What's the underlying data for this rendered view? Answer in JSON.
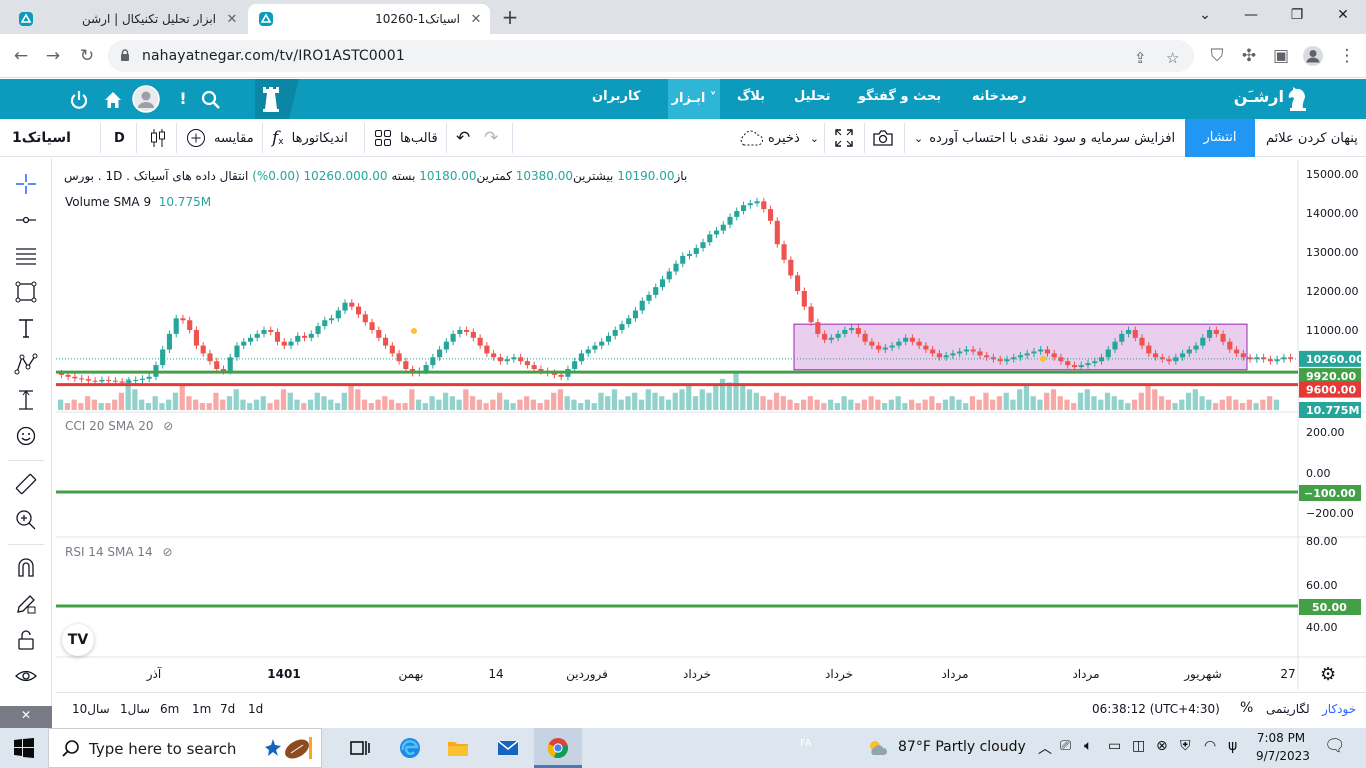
{
  "browser": {
    "tabs": [
      {
        "title": "ابزار تحلیل تکنیکال | ارشن",
        "active": false
      },
      {
        "title": "10260-اسیاتک1",
        "active": true
      }
    ],
    "url": "nahayatnegar.com/tv/IRO1ASTC0001"
  },
  "site_nav": {
    "logo": "ارشـَن",
    "items": [
      "رصدخانه",
      "بحث و گفتگو",
      "تحلیل",
      "بلاگ",
      "ابـزار",
      "کاربران"
    ]
  },
  "toolbar": {
    "symbol": "اسیاتک1",
    "interval": "D",
    "compare": "مقایسه",
    "indicators": "اندیکاتورها",
    "templates": "قالب‌ها",
    "save": "ذخیره",
    "layout_title": "افزایش سرمایه و سود نقدی با احتساب آورده",
    "publish": "انتشار",
    "hide_marks": "پنهان کردن علائم"
  },
  "chart_data": {
    "type": "candlestick",
    "legend": {
      "title": "انتقال داده های آسیاتک . 1D . بورس",
      "open_label": "باز",
      "open": "10190.00",
      "high_label": "بیشترین",
      "high": "10380.00",
      "low_label": "کمترین",
      "low": "10180.00",
      "close_label": "بسته",
      "close": "10260.000.00",
      "change": "(0.00%)",
      "volume_label": "Volume SMA 9",
      "volume_value": "10.775M"
    },
    "price_axis": [
      "15000.00",
      "14000.00",
      "13000.00",
      "12000.00",
      "11000.00"
    ],
    "price_range": [
      9480,
      15000
    ],
    "markers": [
      {
        "label": "10260.00",
        "value": 10260,
        "color": "#26a69a"
      },
      {
        "label": "9920.00",
        "value": 9920,
        "color": "#43a047"
      },
      {
        "label": "9600.00",
        "value": 9600,
        "color": "#e53935"
      },
      {
        "label": "10.775M",
        "value": null,
        "color": "#26a69a"
      }
    ],
    "rectangle": {
      "from_price": 11150,
      "to_price": 9980,
      "color": "#ce93d8"
    },
    "close_series": [
      9850,
      9800,
      9760,
      9740,
      9700,
      9680,
      9720,
      9700,
      9680,
      9650,
      9700,
      9720,
      9750,
      9800,
      10100,
      10500,
      10900,
      11300,
      11250,
      11000,
      10600,
      10400,
      10200,
      10000,
      9950,
      10300,
      10600,
      10700,
      10800,
      10900,
      11000,
      10950,
      10700,
      10600,
      10700,
      10850,
      10800,
      10900,
      11100,
      11250,
      11300,
      11500,
      11700,
      11600,
      11400,
      11200,
      11000,
      10800,
      10600,
      10400,
      10200,
      10000,
      9900,
      9950,
      10100,
      10300,
      10500,
      10700,
      10900,
      11000,
      10950,
      10800,
      10600,
      10400,
      10300,
      10200,
      10250,
      10300,
      10200,
      10100,
      10000,
      9950,
      9900,
      9850,
      9800,
      10000,
      10200,
      10400,
      10500,
      10600,
      10700,
      10850,
      11000,
      11150,
      11300,
      11500,
      11750,
      11900,
      12100,
      12300,
      12500,
      12700,
      12900,
      12950,
      13100,
      13250,
      13450,
      13550,
      13700,
      13900,
      14050,
      14200,
      14250,
      14300,
      14100,
      13800,
      13200,
      12800,
      12400,
      12000,
      11600,
      11200,
      10900,
      10750,
      10800,
      10900,
      11000,
      11050,
      10900,
      10700,
      10600,
      10500,
      10550,
      10600,
      10700,
      10800,
      10700,
      10600,
      10500,
      10400,
      10300,
      10350,
      10400,
      10450,
      10500,
      10450,
      10350,
      10300,
      10250,
      10200,
      10250,
      10300,
      10350,
      10400,
      10450,
      10500,
      10400,
      10300,
      10200,
      10100,
      10050,
      10100,
      10150,
      10200,
      10300,
      10500,
      10700,
      10900,
      11000,
      10800,
      10600,
      10400,
      10300,
      10250,
      10200,
      10300,
      10400,
      10500,
      10600,
      10800,
      11000,
      10900,
      10700,
      10500,
      10400,
      10300,
      10250,
      10300,
      10250,
      10200,
      10250,
      10300,
      10260
    ],
    "volumes": [
      3,
      2,
      3,
      2,
      4,
      3,
      2,
      2,
      3,
      5,
      9,
      6,
      3,
      2,
      4,
      2,
      3,
      5,
      7,
      4,
      3,
      2,
      2,
      5,
      3,
      4,
      6,
      3,
      2,
      3,
      4,
      2,
      3,
      6,
      5,
      3,
      2,
      3,
      5,
      4,
      3,
      2,
      5,
      7,
      6,
      3,
      2,
      3,
      4,
      3,
      2,
      2,
      6,
      3,
      2,
      4,
      3,
      5,
      4,
      3,
      6,
      4,
      3,
      2,
      3,
      5,
      3,
      2,
      3,
      4,
      3,
      2,
      3,
      5,
      6,
      4,
      3,
      2,
      3,
      2,
      5,
      4,
      6,
      3,
      4,
      5,
      3,
      6,
      5,
      4,
      3,
      5,
      6,
      7,
      4,
      6,
      5,
      7,
      9,
      8,
      11,
      7,
      6,
      5,
      4,
      3,
      5,
      4,
      3,
      2,
      3,
      4,
      3,
      2,
      3,
      2,
      4,
      3,
      2,
      3,
      4,
      3,
      2,
      3,
      4,
      2,
      3,
      2,
      3,
      4,
      2,
      3,
      4,
      3,
      2,
      4,
      3,
      5,
      3,
      4,
      5,
      3,
      6,
      7,
      4,
      3,
      5,
      6,
      4,
      3,
      2,
      5,
      6,
      4,
      3,
      5,
      4,
      3,
      2,
      3,
      5,
      7,
      6,
      4,
      3,
      2,
      3,
      5,
      6,
      4,
      3,
      2,
      3,
      4,
      3,
      2,
      3,
      2,
      3,
      4,
      3
    ],
    "time_axis": [
      "آذر",
      "1401",
      "بهمن",
      "14",
      "فروردین",
      "خرداد",
      "خرداد",
      "مرداد",
      "مرداد",
      "شهریور",
      "27"
    ],
    "cci": {
      "label": "CCI 20 SMA 20",
      "axis": [
        "200.00",
        "0.00",
        "−200.00"
      ],
      "level_label": "−100.00"
    },
    "rsi": {
      "label": "RSI 14 SMA 14",
      "axis": [
        "80.00",
        "60.00",
        "40.00"
      ],
      "level_label": "50.00"
    }
  },
  "bottom_bar": {
    "ranges": [
      "10سال",
      "1سال",
      "6m",
      "1m",
      "7d",
      "1d"
    ],
    "clock": "06:38:12 (UTC+4:30)",
    "percent": "%",
    "log": "لگاریتمی",
    "auto": "خودکار"
  },
  "taskbar": {
    "search_placeholder": "Type here to search",
    "weather": "87°F  Partly cloudy",
    "lang": "FA",
    "time": "7:08 PM",
    "date": "9/7/2023"
  },
  "colors": {
    "up": "#26a69a",
    "down": "#ef5350",
    "accent": "#0d9bbd",
    "publish": "#2196f3"
  }
}
